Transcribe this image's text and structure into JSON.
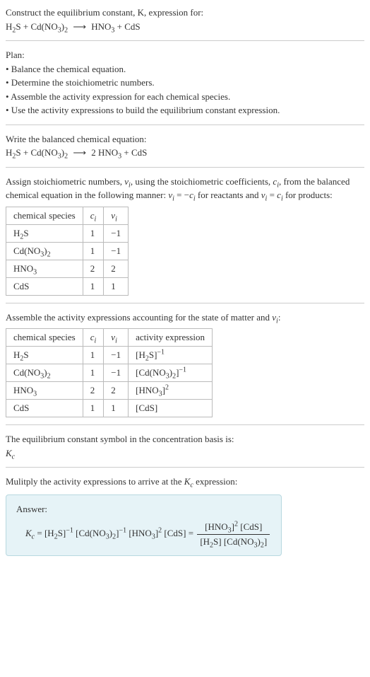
{
  "intro": {
    "title": "Construct the equilibrium constant, K, expression for:",
    "eq_lhs1": "H",
    "eq_lhs1_sub": "2",
    "eq_lhs1b": "S + Cd(NO",
    "eq_lhs1b_sub": "3",
    "eq_lhs1c": ")",
    "eq_lhs1c_sub": "2",
    "eq_rhs1": "HNO",
    "eq_rhs1_sub": "3",
    "eq_rhs1b": " + CdS"
  },
  "plan": {
    "title": "Plan:",
    "b1": "• Balance the chemical equation.",
    "b2": "• Determine the stoichiometric numbers.",
    "b3": "• Assemble the activity expression for each chemical species.",
    "b4": "• Use the activity expressions to build the equilibrium constant expression."
  },
  "balanced": {
    "title": "Write the balanced chemical equation:",
    "lhs1": "H",
    "lhs1_sub": "2",
    "lhs1b": "S + Cd(NO",
    "lhs1b_sub": "3",
    "lhs1c": ")",
    "lhs1c_sub": "2",
    "rhs_coef": "2 HNO",
    "rhs_sub": "3",
    "rhs_b": " + CdS"
  },
  "assign": {
    "t1": "Assign stoichiometric numbers, ",
    "vi": "ν",
    "vi_sub": "i",
    "t2": ", using the stoichiometric coefficients, ",
    "ci": "c",
    "ci_sub": "i",
    "t3": ", from the balanced chemical equation in the following manner: ",
    "eq1a": "ν",
    "eq1b": " = −",
    "eq1c": "c",
    "t4": " for reactants and ",
    "eq2a": "ν",
    "eq2b": " = ",
    "eq2c": "c",
    "t5": " for products:",
    "h1": "chemical species",
    "h2": "c",
    "h3": "ν",
    "r1c1a": "H",
    "r1c1b": "S",
    "r1c2": "1",
    "r1c3": "−1",
    "r2c1a": "Cd(NO",
    "r2c1b": ")",
    "r2c2": "1",
    "r2c3": "−1",
    "r3c1": "HNO",
    "r3c2": "2",
    "r3c3": "2",
    "r4c1": "CdS",
    "r4c2": "1",
    "r4c3": "1"
  },
  "assemble": {
    "t1": "Assemble the activity expressions accounting for the state of matter and ",
    "t2": ":",
    "h1": "chemical species",
    "h2": "c",
    "h3": "ν",
    "h4": "activity expression",
    "r1c1a": "H",
    "r1c1b": "S",
    "r1c2": "1",
    "r1c3": "−1",
    "r1c4p": "−1",
    "r2c1a": "Cd(NO",
    "r2c1b": ")",
    "r2c2": "1",
    "r2c3": "−1",
    "r2c4p": "−1",
    "r3c1": "HNO",
    "r3c2": "2",
    "r3c3": "2",
    "r3c4p": "2",
    "r4c1": "CdS",
    "r4c2": "1",
    "r4c3": "1"
  },
  "symbol": {
    "t1": "The equilibrium constant symbol in the concentration basis is:",
    "k": "K",
    "k_sub": "c"
  },
  "multiply": {
    "t1": "Mulitply the activity expressions to arrive at the ",
    "k": "K",
    "k_sub": "c",
    "t2": " expression:"
  },
  "answer": {
    "label": "Answer:",
    "k": "K",
    "k_sub": "c",
    "eq": " = ",
    "mid_eq": " = "
  }
}
